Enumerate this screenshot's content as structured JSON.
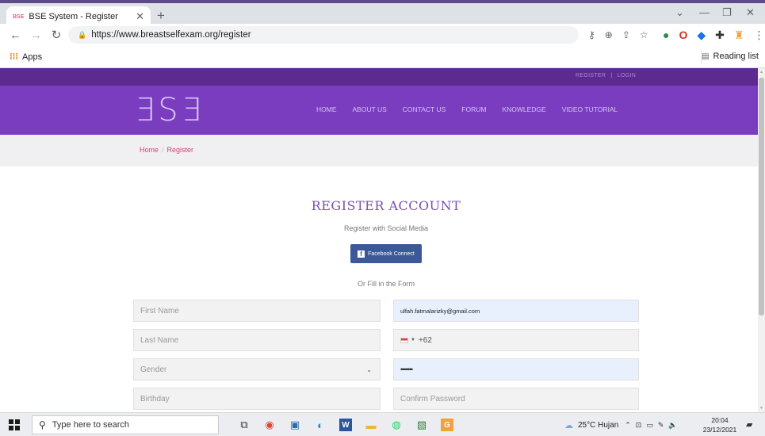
{
  "browser": {
    "tab_title": "BSE System - Register",
    "tab_favicon": "BSE",
    "new_tab": "+",
    "url": "https://www.breastselfexam.org/register",
    "apps_label": "Apps",
    "reading_list": "Reading list"
  },
  "site": {
    "top_links": {
      "register": "REGISTER",
      "separator": "|",
      "login": "LOGIN"
    },
    "logo": "ƎSƎ",
    "nav": [
      "HOME",
      "ABOUT US",
      "CONTACT US",
      "FORUM",
      "KNOWLEDGE",
      "VIDEO TUTORIAL"
    ],
    "breadcrumb": {
      "home": "Home",
      "separator": "/",
      "current": "Register"
    },
    "register": {
      "title": "REGISTER ACCOUNT",
      "social_label": "Register with Social Media",
      "facebook_button": "Facebook Connect",
      "or_label": "Or Fill in the Form"
    },
    "form": {
      "first_name_placeholder": "First Name",
      "last_name_placeholder": "Last Name",
      "gender_value": "Gender",
      "birthday_placeholder": "Birthday",
      "email_value": "ulfah.fatmalarizky@gmail.com",
      "phone_code": "+62",
      "password_value": "•••••••",
      "confirm_password_placeholder": "Confirm Password"
    },
    "colors": {
      "top_bar": "#5d2a92",
      "nav_bar": "#7b3dc0",
      "accent_pink": "#d0447f",
      "facebook": "#3b5998"
    }
  },
  "taskbar": {
    "search_placeholder": "Type here to search",
    "weather": "25°C  Hujan",
    "time": "20:04",
    "date": "23/12/2021"
  }
}
